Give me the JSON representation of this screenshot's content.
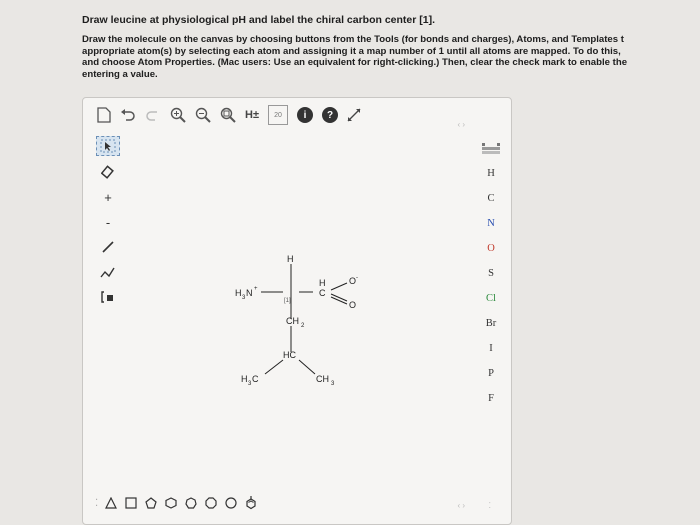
{
  "question": {
    "line1": "Draw leucine at physiological pH and label the chiral carbon center [1].",
    "instructions": "Draw the molecule on the canvas by choosing buttons from the Tools (for bonds and charges), Atoms, and Templates t\nappropriate atom(s) by selecting each atom and assigning it a map number of 1 until all atoms are mapped. To do this,\nand choose Atom Properties. (Mac users: Use an equivalent for right-clicking.) Then, clear the check mark to enable the\nentering a value."
  },
  "toolbar": {
    "h_label": "H±",
    "help_label": "?",
    "info_label": "i",
    "mapnum_label": "20"
  },
  "left_tools": {
    "plus": "+",
    "minus": "-"
  },
  "molecule": {
    "h_top": "H",
    "h3n": "H",
    "h3n_sub": "3",
    "h3n_n": "N",
    "plus": "+",
    "map": "[1]",
    "c_h": "H",
    "c": "C",
    "o_minus": "O",
    "o_minus_charge": "-",
    "o_double": "O",
    "ch2": "CH",
    "ch2_sub": "2",
    "hc": "HC",
    "h3c": "H",
    "h3c_sub": "3",
    "h3c_c": "C",
    "ch3": "CH",
    "ch3_sub": "3"
  },
  "elements": [
    "H",
    "C",
    "N",
    "O",
    "S",
    "Cl",
    "Br",
    "I",
    "P",
    "F"
  ],
  "element_colors": {
    "H": "#333333",
    "C": "#333333",
    "N": "#2a4fb0",
    "O": "#c0392b",
    "S": "#333333",
    "Cl": "#2e8b3e",
    "Br": "#333333",
    "I": "#333333",
    "P": "#333333",
    "F": "#333333"
  },
  "template_shapes": [
    "triangle",
    "square",
    "pentagon",
    "hexagon",
    "heptagon",
    "octagon",
    "nonagon",
    "benzene"
  ]
}
